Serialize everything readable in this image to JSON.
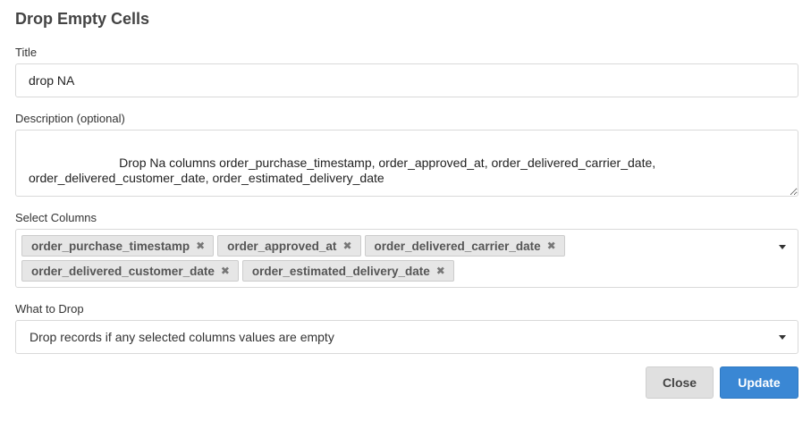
{
  "dialog": {
    "title": "Drop Empty Cells"
  },
  "title_field": {
    "label": "Title",
    "value": "drop NA"
  },
  "description_field": {
    "label": "Description (optional)",
    "value": "                          Drop Na columns order_purchase_timestamp, order_approved_at, order_delivered_carrier_date, order_delivered_customer_date, order_estimated_delivery_date"
  },
  "select_columns": {
    "label": "Select Columns",
    "tags": [
      "order_purchase_timestamp",
      "order_approved_at",
      "order_delivered_carrier_date",
      "order_delivered_customer_date",
      "order_estimated_delivery_date"
    ],
    "remove_glyph": "✖"
  },
  "what_to_drop": {
    "label": "What to Drop",
    "selected": "Drop records if any selected columns values are empty"
  },
  "buttons": {
    "close": "Close",
    "update": "Update"
  }
}
